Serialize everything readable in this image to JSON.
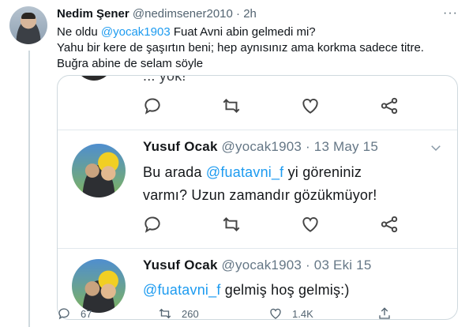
{
  "tweet": {
    "author_name": "Nedim Şener",
    "author_handle": "@nedimsener2010",
    "separator": "·",
    "time": "2h",
    "more": "···",
    "text_part1": "Ne oldu ",
    "mention": "@yocak1903",
    "text_part2": " Fuat Avni abin gelmedi mi?",
    "line2": "Yahu bir kere de şaşırtın beni; hep aynısınız ama korkma sadece titre.",
    "line3": "Buğra abine de selam söyle"
  },
  "quote_screenshot": {
    "top_fragment": "... yok!",
    "tweets": [
      {
        "name": "Yusuf Ocak",
        "handle": "@yocak1903",
        "dot": "·",
        "date": "13 May 15",
        "text_a": "Bu arada ",
        "mention": "@fuatavni_f",
        "text_b": " yi göreniniz",
        "text_c": "varmı? Uzun zamandır gözükmüyor!"
      },
      {
        "name": "Yusuf Ocak",
        "handle": "@yocak1903",
        "dot": "·",
        "date": "03 Eki 15",
        "mention": "@fuatavni_f",
        "text_b": " gelmiş hoş gelmiş:)"
      }
    ]
  },
  "actions": {
    "replies": "67",
    "retweets": "260",
    "likes": "1.4K"
  },
  "colors": {
    "accent": "#1d9bf0",
    "muted": "#536471",
    "border": "#cfd9de"
  },
  "icons": [
    "reply-icon",
    "retweet-icon",
    "like-icon",
    "share-icon",
    "more-icon",
    "chevron-down-icon"
  ]
}
